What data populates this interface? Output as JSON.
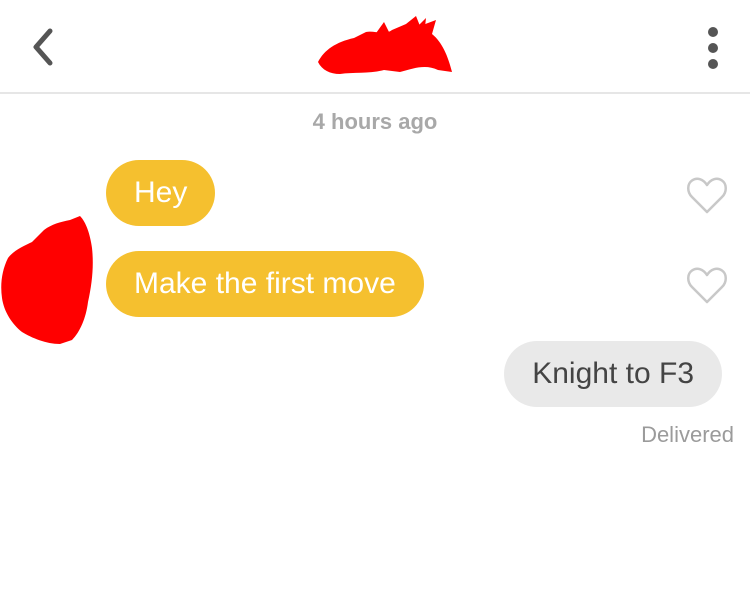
{
  "header": {
    "back_icon": "chevron-left-icon",
    "more_icon": "vertical-ellipsis-icon"
  },
  "conversation": {
    "timestamp": "4 hours ago",
    "messages": [
      {
        "direction": "incoming",
        "text": "Hey",
        "like_icon": "heart-outline-icon"
      },
      {
        "direction": "incoming",
        "text": "Make the first move",
        "like_icon": "heart-outline-icon"
      },
      {
        "direction": "outgoing",
        "text": "Knight to F3"
      }
    ],
    "delivery_status": "Delivered"
  },
  "colors": {
    "incoming_bubble": "#f5c02f",
    "outgoing_bubble": "#e9e9e9",
    "redaction": "#ff0000",
    "muted_text": "#a8a8a8"
  }
}
